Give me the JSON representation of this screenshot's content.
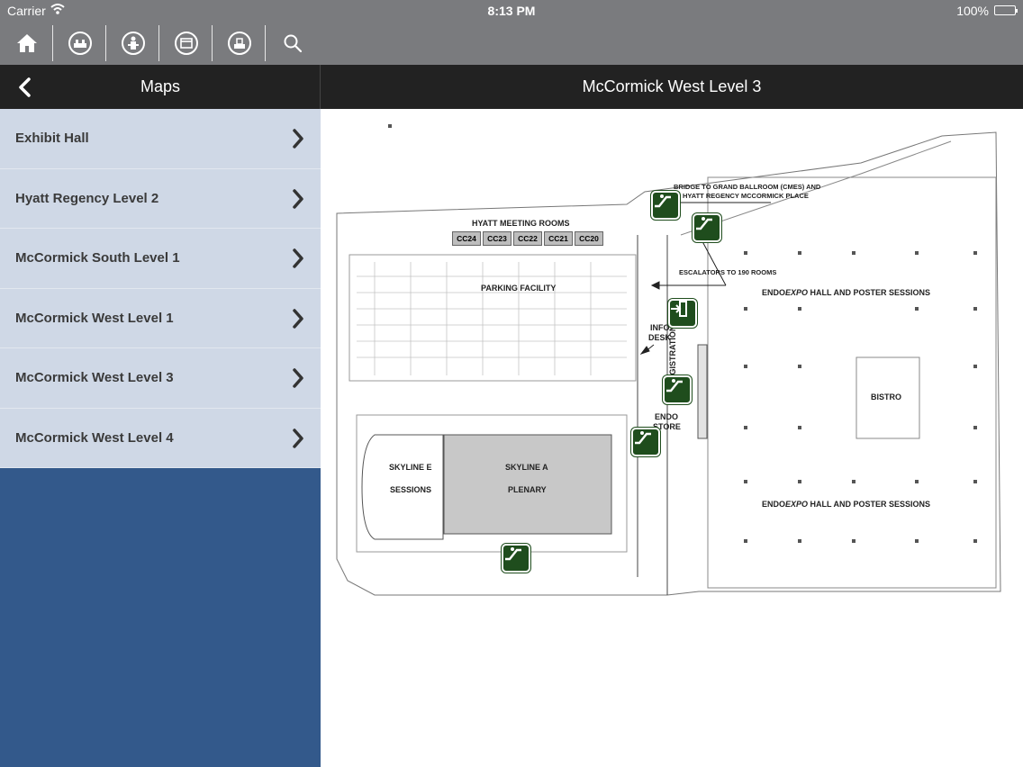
{
  "status_bar": {
    "carrier": "Carrier",
    "time": "8:13 PM",
    "battery": "100%"
  },
  "toolbar": {
    "icons": [
      "home-icon",
      "exhibits-icon",
      "speaker-icon",
      "calendar-icon",
      "booth-icon",
      "search-icon"
    ]
  },
  "nav": {
    "title": "Maps"
  },
  "maps_list": [
    {
      "label": "Exhibit Hall"
    },
    {
      "label": "Hyatt Regency Level 2"
    },
    {
      "label": "McCormick South Level 1"
    },
    {
      "label": "McCormick West Level 1"
    },
    {
      "label": "McCormick West Level 3"
    },
    {
      "label": "McCormick West Level 4"
    }
  ],
  "detail": {
    "title": "McCormick West Level 3"
  },
  "map": {
    "hyatt_meeting_rooms": "HYATT MEETING ROOMS",
    "rooms": [
      "CC24",
      "CC23",
      "CC22",
      "CC21",
      "CC20"
    ],
    "bridge_line1": "BRIDGE TO GRAND BALLROOM (CMES) AND",
    "bridge_line2": "HYATT REGENCY MCCORMICK PLACE",
    "escalators": "ESCALATORS TO 190 ROOMS",
    "parking": "PARKING FACILITY",
    "info1": "INFO",
    "info2": "DESK",
    "endo1": "ENDO",
    "endo2": "STORE",
    "registration": "REGISTRATION",
    "bistro": "BISTRO",
    "expo_prefix": "ENDO",
    "expo_italic": "EXPO",
    "expo_suffix": " HALL AND POSTER SESSIONS",
    "skyline_e1": "SKYLINE E",
    "skyline_e2": "SESSIONS",
    "skyline_a1": "SKYLINE A",
    "skyline_a2": "PLENARY"
  },
  "colors": {
    "toolbar": "#7a7b7e",
    "navbar": "#222222",
    "list_bg": "#cfd8e6",
    "sidebar_bg": "#33598b",
    "marker": "#1f4d1d",
    "plenary": "#c8c8c8"
  }
}
